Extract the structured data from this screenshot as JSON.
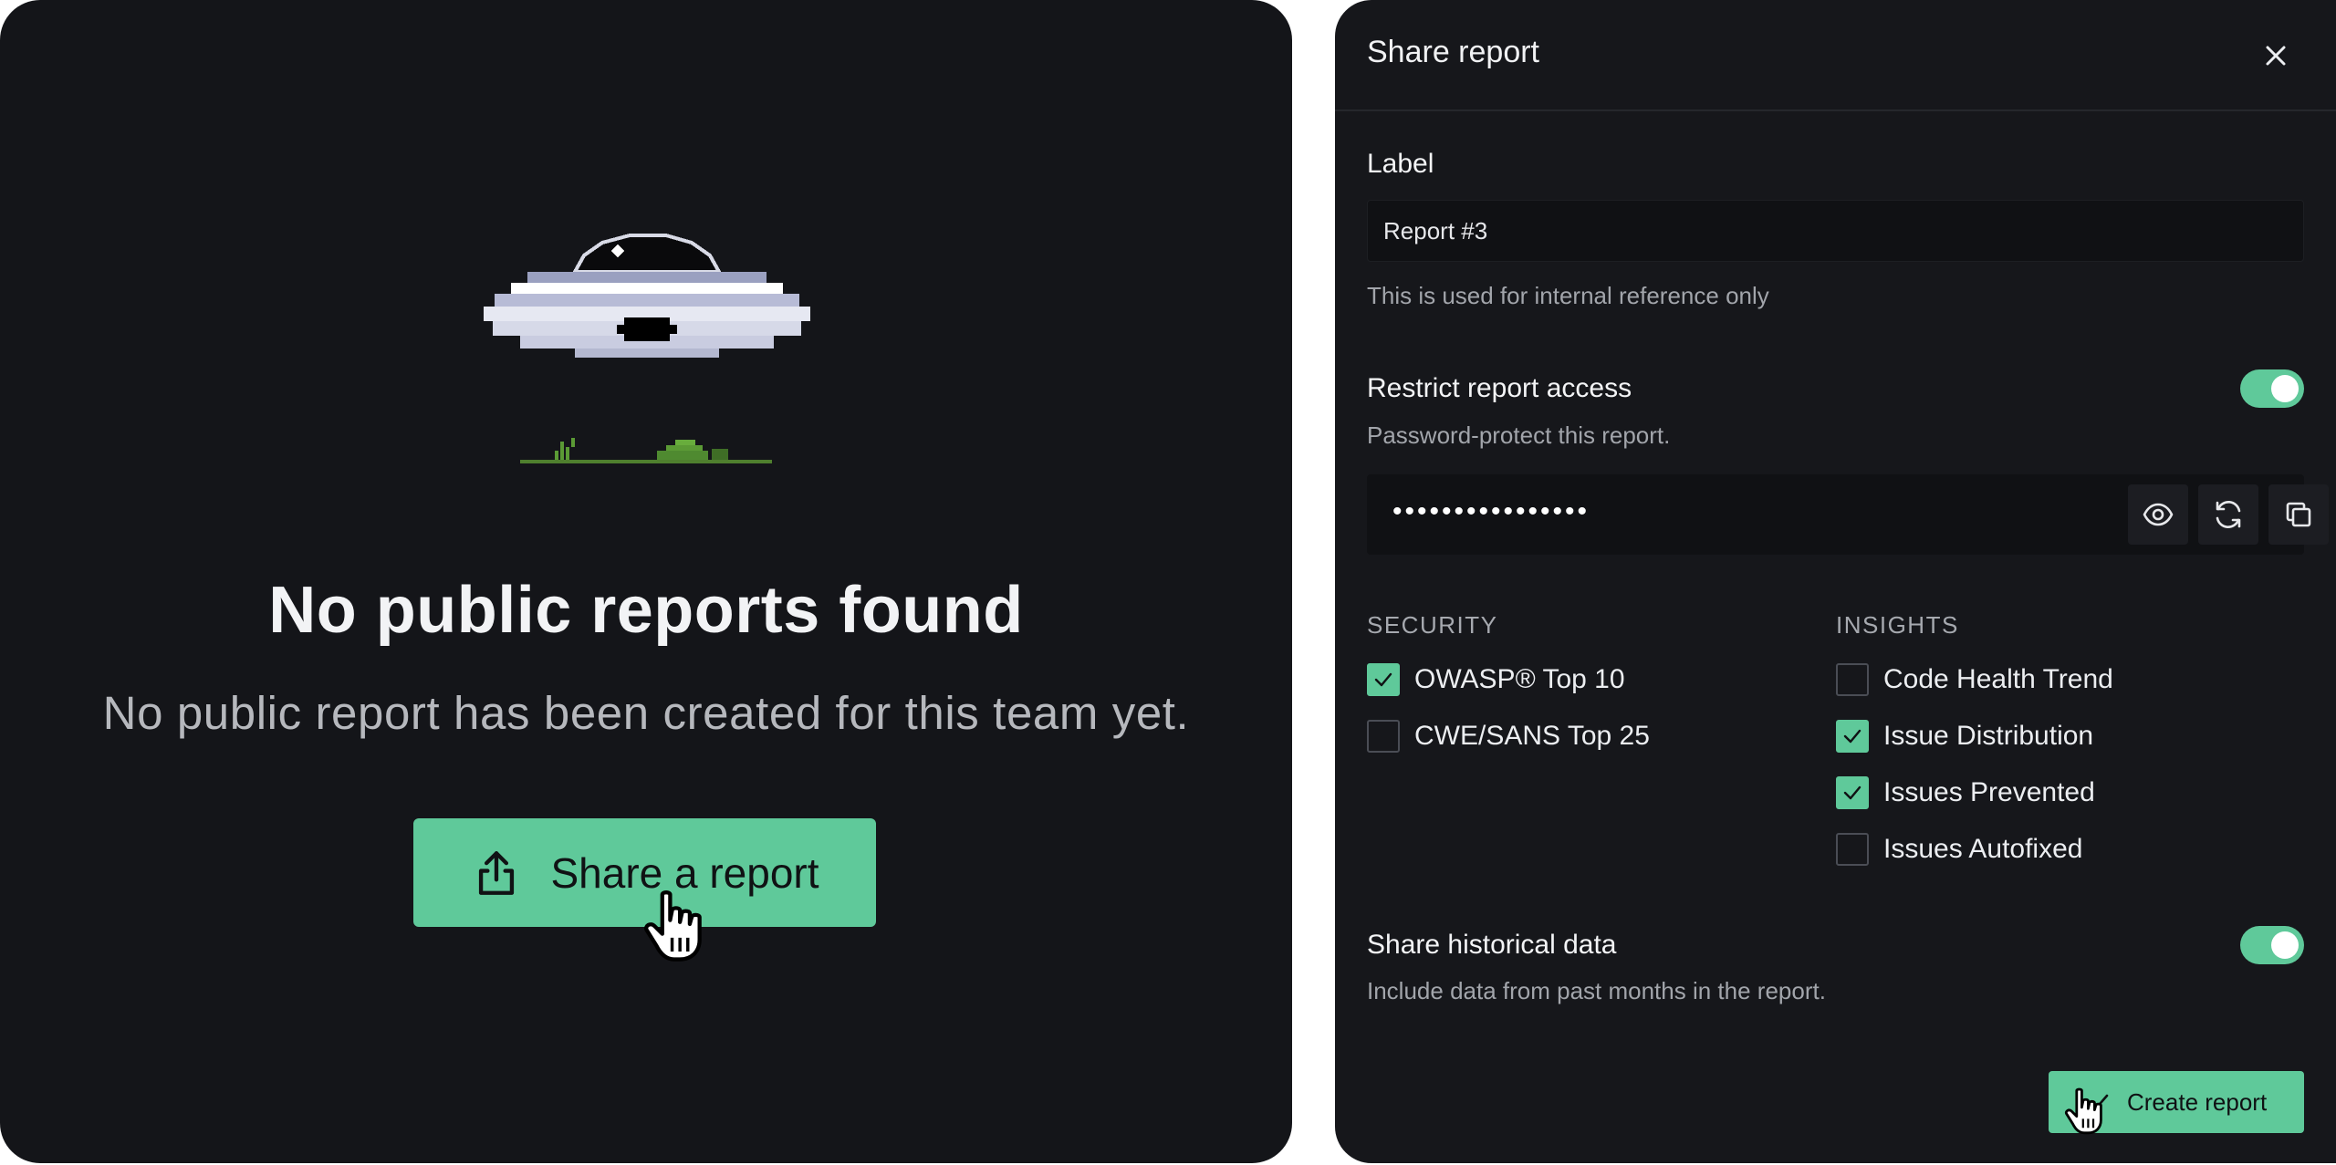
{
  "empty_state": {
    "title": "No public reports found",
    "subtitle": "No public report has been created for this team yet.",
    "cta_label": "Share a report",
    "illustration": "ufo-pixel-art-icon"
  },
  "modal": {
    "title": "Share report",
    "close_icon": "close-icon",
    "label_field": {
      "label": "Label",
      "value": "Report #3",
      "helper": "This is used for internal reference only"
    },
    "restrict_access": {
      "label": "Restrict report access",
      "helper": "Password-protect this report.",
      "enabled": true,
      "password_mask": "••••••••••••••••",
      "buttons": [
        "eye-icon",
        "refresh-icon",
        "copy-icon"
      ]
    },
    "security": {
      "heading": "SECURITY",
      "items": [
        {
          "label": "OWASP® Top 10",
          "checked": true
        },
        {
          "label": "CWE/SANS Top 25",
          "checked": false
        }
      ]
    },
    "insights": {
      "heading": "INSIGHTS",
      "items": [
        {
          "label": "Code Health Trend",
          "checked": false
        },
        {
          "label": "Issue Distribution",
          "checked": true
        },
        {
          "label": "Issues Prevented",
          "checked": true
        },
        {
          "label": "Issues Autofixed",
          "checked": false
        }
      ]
    },
    "historical": {
      "label": "Share historical data",
      "helper": "Include data from past months in the report.",
      "enabled": true
    },
    "create_label": "Create report"
  },
  "colors": {
    "accent": "#5fc99a",
    "panel_bg": "#141519",
    "modal_bg": "#16171b",
    "input_bg": "#101114"
  }
}
